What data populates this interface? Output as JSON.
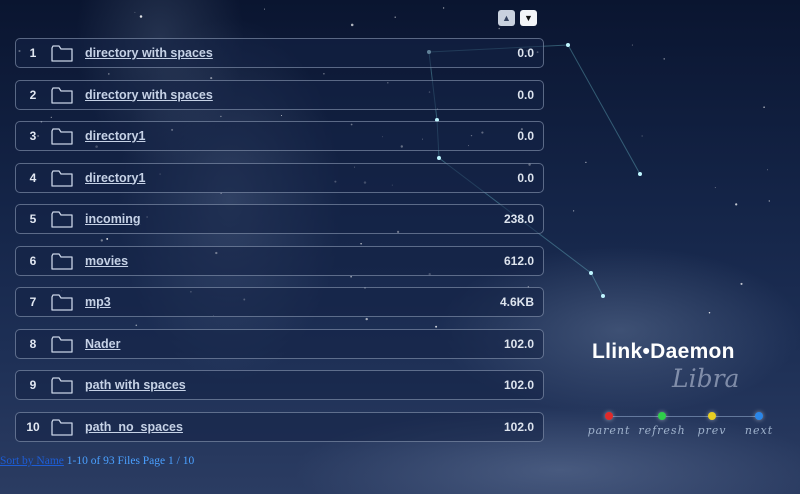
{
  "sort_controls": {
    "up_icon": "triangle-up-icon",
    "down_icon": "triangle-down-icon"
  },
  "files": [
    {
      "index": "1",
      "name": "directory with spaces",
      "size": "0.0",
      "icon": "folder-icon"
    },
    {
      "index": "2",
      "name": "directory with spaces",
      "size": "0.0",
      "icon": "folder-icon"
    },
    {
      "index": "3",
      "name": "directory1",
      "size": "0.0",
      "icon": "folder-icon"
    },
    {
      "index": "4",
      "name": "directory1",
      "size": "0.0",
      "icon": "folder-icon"
    },
    {
      "index": "5",
      "name": "incoming",
      "size": "238.0",
      "icon": "folder-icon"
    },
    {
      "index": "6",
      "name": "movies",
      "size": "612.0",
      "icon": "folder-icon"
    },
    {
      "index": "7",
      "name": "mp3",
      "size": "4.6KB",
      "icon": "folder-icon"
    },
    {
      "index": "8",
      "name": "Nader",
      "size": "102.0",
      "icon": "folder-icon"
    },
    {
      "index": "9",
      "name": "path with spaces",
      "size": "102.0",
      "icon": "folder-icon"
    },
    {
      "index": "10",
      "name": "path_no_spaces",
      "size": "102.0",
      "icon": "folder-icon"
    }
  ],
  "footer": {
    "link": "Sort by Name",
    "status": "1-10 of 93 Files Page 1 / 10"
  },
  "brand": {
    "name": "Llink•Daemon",
    "skin": "Libra"
  },
  "nav": [
    {
      "label": "parent",
      "color": "#e02a2a"
    },
    {
      "label": "refresh",
      "color": "#2fcf4a"
    },
    {
      "label": "prev",
      "color": "#e8cf22"
    },
    {
      "label": "next",
      "color": "#2a86e8"
    }
  ]
}
